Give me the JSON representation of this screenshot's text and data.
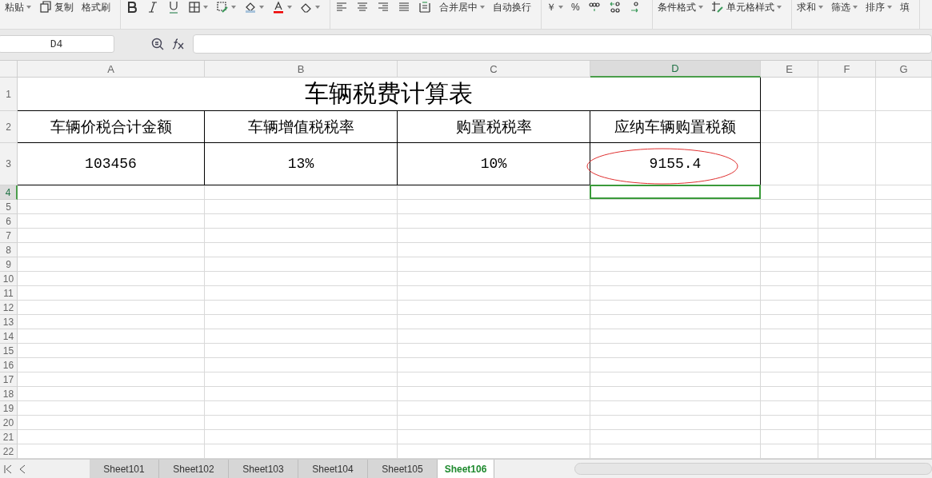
{
  "toolbar": {
    "groups": [
      {
        "items": [
          {
            "kind": "text",
            "label": "粘贴",
            "dropdown": true
          },
          {
            "kind": "copy",
            "label": "复制",
            "dropdown": false
          },
          {
            "kind": "text",
            "label": "格式刷",
            "dropdown": false
          }
        ]
      },
      {
        "items": [
          {
            "kind": "bold"
          },
          {
            "kind": "italic"
          },
          {
            "kind": "underline"
          },
          {
            "kind": "borders",
            "dropdown": true
          },
          {
            "kind": "merge-style",
            "dropdown": true
          },
          {
            "kind": "fill",
            "dropdown": true
          },
          {
            "kind": "font-color",
            "dropdown": true
          },
          {
            "kind": "eraser",
            "dropdown": true
          }
        ]
      },
      {
        "items": [
          {
            "kind": "align-left"
          },
          {
            "kind": "align-center"
          },
          {
            "kind": "align-right"
          },
          {
            "kind": "justify"
          },
          {
            "kind": "distribute"
          },
          {
            "kind": "text",
            "label": "合并居中",
            "dropdown": true
          },
          {
            "kind": "text",
            "label": "自动换行",
            "dropdown": false
          }
        ]
      },
      {
        "items": [
          {
            "kind": "text",
            "label": "￥",
            "dropdown": true
          },
          {
            "kind": "text",
            "label": "%",
            "dropdown": false
          },
          {
            "kind": "thousands"
          },
          {
            "kind": "inc-decimal"
          },
          {
            "kind": "dec-decimal"
          }
        ]
      },
      {
        "items": [
          {
            "kind": "text",
            "label": "条件格式",
            "dropdown": true
          },
          {
            "kind": "cell-style",
            "label": "单元格样式",
            "dropdown": true
          }
        ]
      },
      {
        "items": [
          {
            "kind": "text",
            "label": "求和",
            "dropdown": true
          },
          {
            "kind": "text",
            "label": "筛选",
            "dropdown": true
          },
          {
            "kind": "text",
            "label": "排序",
            "dropdown": true
          },
          {
            "kind": "text",
            "label": "填",
            "dropdown": false
          }
        ]
      }
    ]
  },
  "formula_bar": {
    "name_box": "D4"
  },
  "columns": [
    {
      "label": "A",
      "selected": false
    },
    {
      "label": "B",
      "selected": false
    },
    {
      "label": "C",
      "selected": false
    },
    {
      "label": "D",
      "selected": true
    },
    {
      "label": "E",
      "selected": false
    },
    {
      "label": "F",
      "selected": false
    },
    {
      "label": "G",
      "selected": false
    }
  ],
  "rows": [
    {
      "label": "1",
      "selected": false
    },
    {
      "label": "2",
      "selected": false
    },
    {
      "label": "3",
      "selected": false
    },
    {
      "label": "4",
      "selected": true
    },
    {
      "label": "5",
      "selected": false
    },
    {
      "label": "6",
      "selected": false
    },
    {
      "label": "7",
      "selected": false
    },
    {
      "label": "8",
      "selected": false
    },
    {
      "label": "9",
      "selected": false
    },
    {
      "label": "10",
      "selected": false
    },
    {
      "label": "11",
      "selected": false
    },
    {
      "label": "12",
      "selected": false
    },
    {
      "label": "13",
      "selected": false
    },
    {
      "label": "14",
      "selected": false
    },
    {
      "label": "15",
      "selected": false
    },
    {
      "label": "16",
      "selected": false
    },
    {
      "label": "17",
      "selected": false
    },
    {
      "label": "18",
      "selected": false
    },
    {
      "label": "19",
      "selected": false
    },
    {
      "label": "20",
      "selected": false
    },
    {
      "label": "21",
      "selected": false
    },
    {
      "label": "22",
      "selected": false
    }
  ],
  "sheet": {
    "title": "车辆税费计算表",
    "headers": [
      "车辆价税合计金额",
      "车辆增值税税率",
      "购置税税率",
      "应纳车辆购置税额"
    ],
    "values": [
      {
        "text": "103456",
        "circled": false
      },
      {
        "text": "13%",
        "circled": false
      },
      {
        "text": "10%",
        "circled": false
      },
      {
        "text": "9155.4",
        "circled": true
      }
    ]
  },
  "sheet_tabs": [
    {
      "label": "Sheet101",
      "selected": false
    },
    {
      "label": "Sheet102",
      "selected": false
    },
    {
      "label": "Sheet103",
      "selected": false
    },
    {
      "label": "Sheet104",
      "selected": false
    },
    {
      "label": "Sheet105",
      "selected": false
    },
    {
      "label": "Sheet106",
      "selected": true
    }
  ]
}
